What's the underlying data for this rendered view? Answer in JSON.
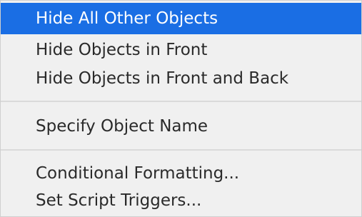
{
  "menu": {
    "items": [
      {
        "label": "Hide All Other Objects",
        "highlighted": true
      },
      {
        "label": "Hide Objects in Front"
      },
      {
        "label": "Hide Objects in Front and Back"
      },
      {
        "label": "Specify Object Name"
      },
      {
        "label": "Conditional Formatting..."
      },
      {
        "label": "Set Script Triggers..."
      }
    ]
  },
  "colors": {
    "highlight": "#1a6ee4",
    "menu_background": "#f0f0f0",
    "text": "#2a2a2a"
  }
}
